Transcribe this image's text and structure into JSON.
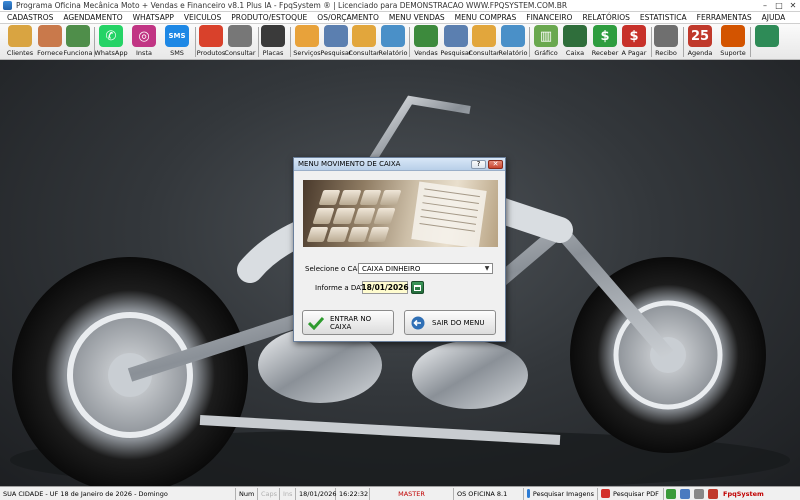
{
  "window": {
    "title": "Programa Oficina Mecânica Moto + Vendas e Financeiro v8.1 Plus IA - FpqSystem ® | Licenciado para  DEMONSTRACAO WWW.FPQSYSTEM.COM.BR"
  },
  "menu": [
    "CADASTROS",
    "AGENDAMENTO",
    "WHATSAPP",
    "VEICULOS",
    "PRODUTO/ESTOQUE",
    "OS/ORÇAMENTO",
    "MENU VENDAS",
    "MENU COMPRAS",
    "FINANCEIRO",
    "RELATÓRIOS",
    "ESTATISTICA",
    "FERRAMENTAS",
    "AJUDA"
  ],
  "toolbar": [
    {
      "label": "Clientes",
      "icon": "clients-icon",
      "color": "#d9a441"
    },
    {
      "label": "Fornece",
      "icon": "supplier-icon",
      "color": "#c9794b"
    },
    {
      "label": "Funciona",
      "icon": "employee-icon",
      "color": "#4f8e4a"
    },
    {
      "label": "WhatsApp",
      "icon": "whatsapp-icon",
      "color": "#25d366"
    },
    {
      "label": "Insta",
      "icon": "instagram-icon",
      "color": "#c13584"
    },
    {
      "label": "SMS",
      "icon": "sms-icon",
      "color": "#1e88e5"
    },
    {
      "label": "Produtos",
      "icon": "products-icon",
      "color": "#d9412b"
    },
    {
      "label": "Consultar",
      "icon": "consult-products-icon",
      "color": "#777777"
    },
    {
      "label": "Placas",
      "icon": "plates-icon",
      "color": "#3a3a3a"
    },
    {
      "label": "Serviços",
      "icon": "services-icon",
      "color": "#e8a23a"
    },
    {
      "label": "Pesquisar",
      "icon": "search-os-icon",
      "color": "#5b7fb0"
    },
    {
      "label": "Consultar",
      "icon": "consult-os-icon",
      "color": "#e2a63c"
    },
    {
      "label": "Relatório",
      "icon": "report-os-icon",
      "color": "#4a90c8"
    },
    {
      "label": "Vendas",
      "icon": "sales-cart-icon",
      "color": "#3d8a3d"
    },
    {
      "label": "Pesquisar",
      "icon": "search-sales-icon",
      "color": "#5b7fb0"
    },
    {
      "label": "Consultar",
      "icon": "consult-sales-icon",
      "color": "#e2a63c"
    },
    {
      "label": "Relatório",
      "icon": "report-sales-icon",
      "color": "#4a90c8"
    },
    {
      "label": "Gráfico",
      "icon": "chart-icon",
      "color": "#6aa84f"
    },
    {
      "label": "Caixa",
      "icon": "cash-register-icon",
      "color": "#2f6e3b"
    },
    {
      "label": "Receber",
      "icon": "receive-money-icon",
      "color": "#2e9d3f"
    },
    {
      "label": "A Pagar",
      "icon": "pay-money-icon",
      "color": "#c7312a"
    },
    {
      "label": "Recibo",
      "icon": "receipt-icon",
      "color": "#6f6f6f"
    },
    {
      "label": "Agenda",
      "icon": "calendar-icon",
      "color": "#c0392b"
    },
    {
      "label": "Suporte",
      "icon": "support-icon",
      "color": "#d35400"
    },
    {
      "label": "",
      "icon": "exit-icon",
      "color": "#2e8b57"
    }
  ],
  "dialog": {
    "title": "MENU MOVIMENTO DE CAIXA",
    "help_glyph": "?",
    "close_glyph": "✕",
    "select_label": "Selecione o CAIXA",
    "select_value": "CAIXA DINHEIRO",
    "date_label": "Informe a DATA",
    "date_value": "18/01/2026",
    "enter_button": "ENTRAR NO CAIXA",
    "exit_button": "SAIR DO MENU"
  },
  "statusbar": {
    "city": "SUA CIDADE - UF 18 de Janeiro de 2026 - Domingo",
    "num": "Num",
    "caps": "Caps",
    "ins": "Ins",
    "date": "18/01/2026",
    "time": "16:22:32",
    "user": "MASTER",
    "version": "OS OFICINA 8.1",
    "images": "Pesquisar Imagens",
    "pdf": "Pesquisar PDF",
    "brand": "FpqSystem"
  },
  "colors": {
    "master": "#c00000",
    "dialog_title_bar": "#c8dbef",
    "date_field_bg": "#fffccf"
  }
}
